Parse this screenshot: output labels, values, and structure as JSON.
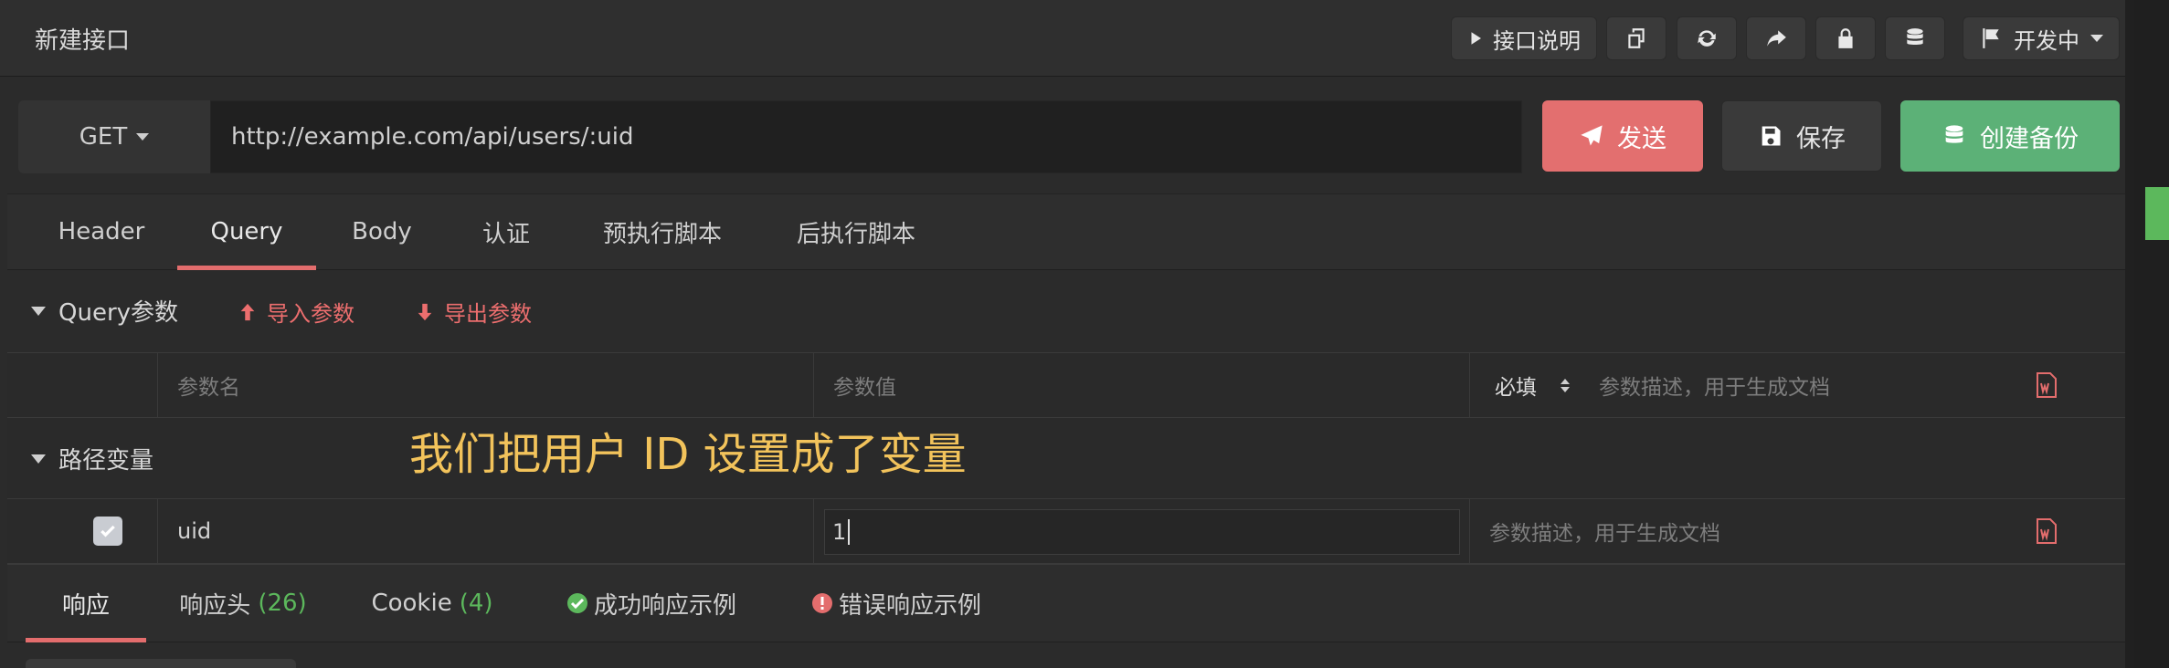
{
  "window": {
    "title": "新建接口"
  },
  "toolbar": {
    "doc_label": "接口说明",
    "status_label": "开发中"
  },
  "request": {
    "method": "GET",
    "url": "http://example.com/api/users/:uid",
    "send_label": "发送",
    "save_label": "保存",
    "backup_label": "创建备份"
  },
  "tabs": [
    {
      "label": "Header"
    },
    {
      "label": "Query"
    },
    {
      "label": "Body"
    },
    {
      "label": "认证"
    },
    {
      "label": "预执行脚本"
    },
    {
      "label": "后执行脚本"
    }
  ],
  "query_section": {
    "title": "Query参数",
    "import_label": "导入参数",
    "export_label": "导出参数",
    "name_placeholder": "参数名",
    "value_placeholder": "参数值",
    "required_label": "必填",
    "desc_placeholder": "参数描述，用于生成文档"
  },
  "path_section": {
    "title": "路径变量",
    "rows": [
      {
        "checked": true,
        "name": "uid",
        "value": "1",
        "desc_placeholder": "参数描述，用于生成文档"
      }
    ]
  },
  "annotation": "我们把用户 ID 设置成了变量",
  "response_tabs": {
    "response": "响应",
    "headers_label": "响应头",
    "headers_count": "(26)",
    "cookie_label": "Cookie",
    "cookie_count": "(4)",
    "success_label": "成功响应示例",
    "error_label": "错误响应示例"
  },
  "colors": {
    "send": "#e36f6f",
    "backup": "#5cb177",
    "accent_red": "#e36d6d",
    "count_green": "#5cb85c",
    "annotation": "#f2c35b"
  }
}
